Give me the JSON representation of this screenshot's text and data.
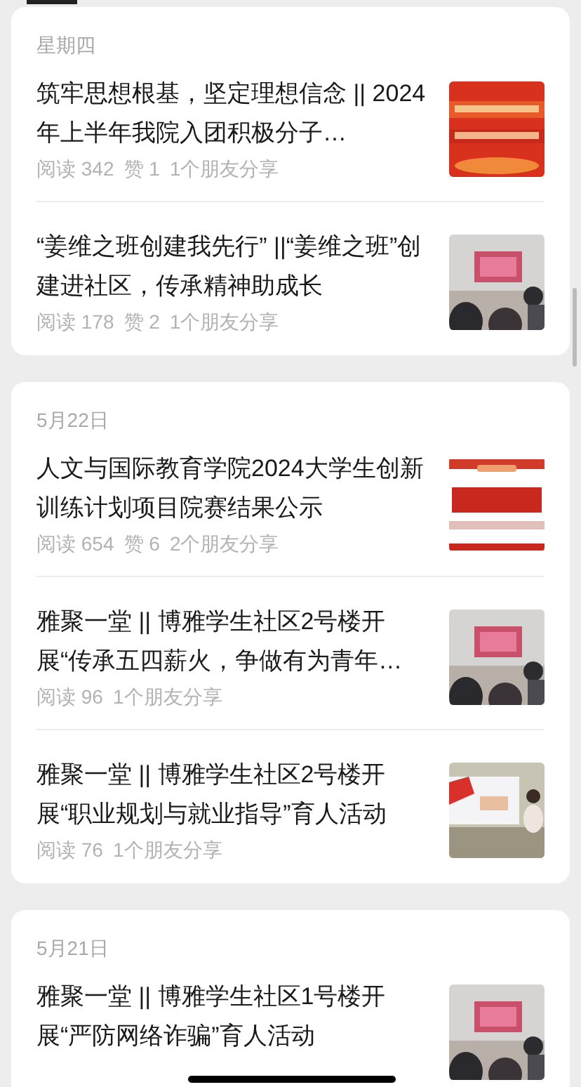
{
  "sections": [
    {
      "date": "星期四",
      "articles": [
        {
          "title": "筑牢思想根基，坚定理想信念 || 2024年上半年我院入团积极分子…",
          "stats": [
            "阅读 342",
            "赞 1",
            "1个朋友分享"
          ],
          "thumbnail": {
            "kind": "picture"
          }
        },
        {
          "title": "“姜维之班创建我先行” ||“姜维之班”创建进社区，传承精神助成长",
          "stats": [
            "阅读 178",
            "赞 2",
            "1个朋友分享"
          ],
          "thumbnail": {
            "kind": "picture"
          }
        }
      ]
    },
    {
      "date": "5月22日",
      "articles": [
        {
          "title": "人文与国际教育学院2024大学生创新训练计划项目院赛结果公示",
          "stats": [
            "阅读 654",
            "赞 6",
            "2个朋友分享"
          ],
          "thumbnail": {
            "kind": "picture"
          }
        },
        {
          "title": "雅聚一堂 || 博雅学生社区2号楼开展“传承五四薪火，争做有为青年…",
          "stats": [
            "阅读 96",
            "1个朋友分享"
          ],
          "thumbnail": {
            "kind": "picture"
          }
        },
        {
          "title": "雅聚一堂 || 博雅学生社区2号楼开展“职业规划与就业指导”育人活动",
          "stats": [
            "阅读 76",
            "1个朋友分享"
          ],
          "thumbnail": {
            "kind": "picture"
          }
        }
      ]
    },
    {
      "date": "5月21日",
      "articles": [
        {
          "title": "雅聚一堂 || 博雅学生社区1号楼开展“严防网络诈骗”育人活动",
          "thumbnail": {
            "kind": "picture"
          }
        }
      ]
    }
  ]
}
